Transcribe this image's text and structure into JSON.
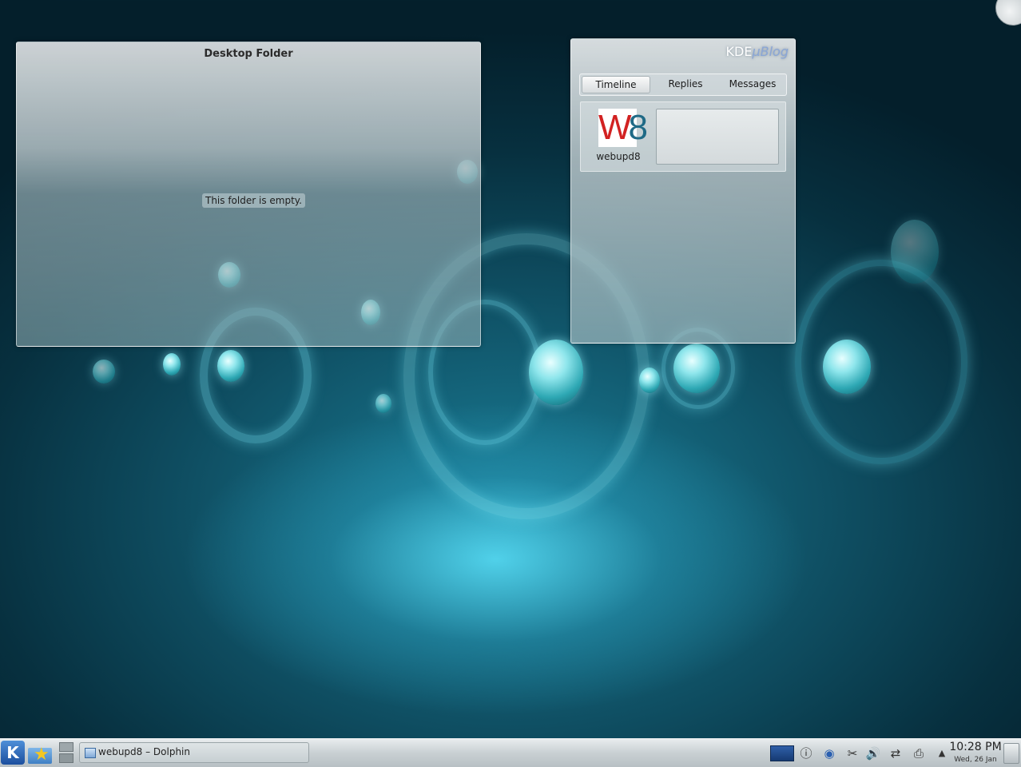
{
  "desktop_folder": {
    "title": "Desktop Folder",
    "empty_message": "This folder is empty."
  },
  "microblog": {
    "logo_kde": "KDE",
    "logo_mu": "μBlog",
    "tabs": [
      {
        "label": "Timeline",
        "active": true
      },
      {
        "label": "Replies",
        "active": false
      },
      {
        "label": "Messages",
        "active": false
      }
    ],
    "post": {
      "avatar_text_w": "W",
      "avatar_text_8": "8",
      "username": "webupd8"
    }
  },
  "taskbar": {
    "kickoff_label": "K",
    "task_label": "webupd8 – Dolphin",
    "tray_icons": [
      "desktop-pager-icon",
      "info-icon",
      "browser-icon",
      "klipper-scissors-icon",
      "volume-icon",
      "network-icon",
      "printer-icon",
      "expand-arrow-icon"
    ],
    "clock_time": "10:28 PM",
    "clock_date": "Wed, 26 Jan"
  },
  "colors": {
    "accent": "#4f8fd8",
    "wallpaper_glow": "#5ae1fa",
    "avatar_red": "#d22222",
    "avatar_teal": "#1f6a86"
  }
}
